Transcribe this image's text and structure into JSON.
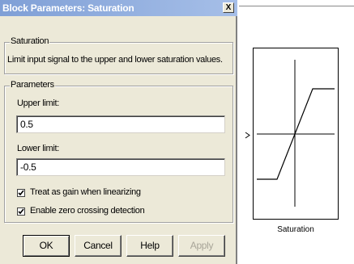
{
  "dialog": {
    "title": "Block Parameters: Saturation",
    "close_glyph": "X",
    "description_group": {
      "legend": "Saturation",
      "description": "Limit input signal to the upper and lower saturation values."
    },
    "parameters_group": {
      "legend": "Parameters",
      "upper_label": "Upper limit:",
      "upper_value": "0.5",
      "lower_label": "Lower limit:",
      "lower_value": "-0.5",
      "checkbox_linearize": {
        "label": "Treat as gain when linearizing",
        "checked": true
      },
      "checkbox_zero_crossing": {
        "label": "Enable zero crossing detection",
        "checked": true
      }
    },
    "buttons": {
      "ok": "OK",
      "cancel": "Cancel",
      "help": "Help",
      "apply": "Apply"
    }
  },
  "model": {
    "block_name": "Saturation",
    "block_icon": "saturation-curve-icon"
  }
}
